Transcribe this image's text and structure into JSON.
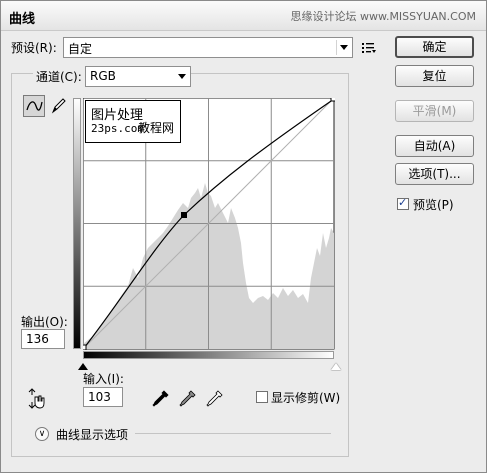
{
  "window": {
    "title": "曲线",
    "watermark": "思缘设计论坛 www.MISSYUAN.COM"
  },
  "preset": {
    "label": "预设(R):",
    "value": "自定"
  },
  "channel": {
    "label": "通道(C):",
    "value": "RGB"
  },
  "buttons": {
    "ok": "确定",
    "reset": "复位",
    "smooth": "平滑(M)",
    "auto": "自动(A)",
    "options": "选项(T)..."
  },
  "preview": {
    "label": "预览(P)",
    "checked": true
  },
  "output": {
    "label": "输出(O):",
    "value": "136"
  },
  "input": {
    "label": "输入(I):",
    "value": "103"
  },
  "show_clipping": {
    "label": "显示修剪(W)",
    "checked": false
  },
  "curve_display": {
    "label": "曲线显示选项"
  },
  "overlay": {
    "line1": "图片处理",
    "line2": "23ps.com",
    "line3": "教程网"
  },
  "curve": {
    "control_point": {
      "input": 103,
      "output": 136
    }
  },
  "icons": {
    "preset_menu": "preset-menu-icon",
    "curve_tool": "curve-tool-icon",
    "pencil_tool": "pencil-tool-icon",
    "hand_tool": "on-image-adjust-icon",
    "black_eyedropper": "black-point-eyedropper-icon",
    "gray_eyedropper": "gray-point-eyedropper-icon",
    "white_eyedropper": "white-point-eyedropper-icon",
    "expand": "expand-chevron-icon"
  }
}
